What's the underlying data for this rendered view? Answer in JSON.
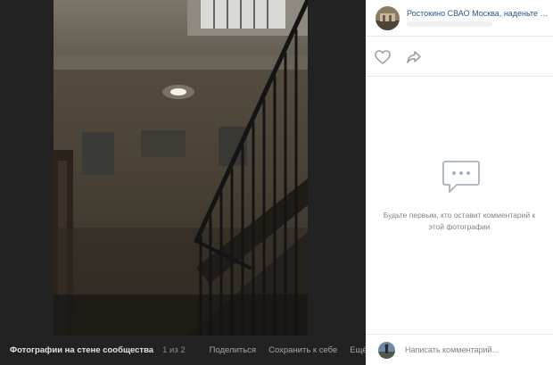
{
  "viewer": {
    "photo_alt": "",
    "bottom": {
      "album_title": "Фотографии на стене сообщества",
      "counter": "1 из 2",
      "share_label": "Поделиться",
      "save_label": "Сохранить к себе",
      "more_label": "Ещё"
    }
  },
  "side": {
    "author_name": "Ростокино СВАО Москва, наденьте маски!",
    "empty_comments_text": "Будьте первым, кто оставит комментарий к этой фотографии"
  },
  "comment": {
    "placeholder": "Написать комментарий..."
  },
  "icons": {
    "like": "heart-icon",
    "share": "share-arrow-icon",
    "empty": "comment-bubble-icon",
    "more": "chevron-down-icon"
  },
  "colors": {
    "viewer_bg": "#222222",
    "panel_bg": "#ffffff",
    "link": "#2a5885",
    "muted": "#828282",
    "icon": "#99a2ad"
  }
}
